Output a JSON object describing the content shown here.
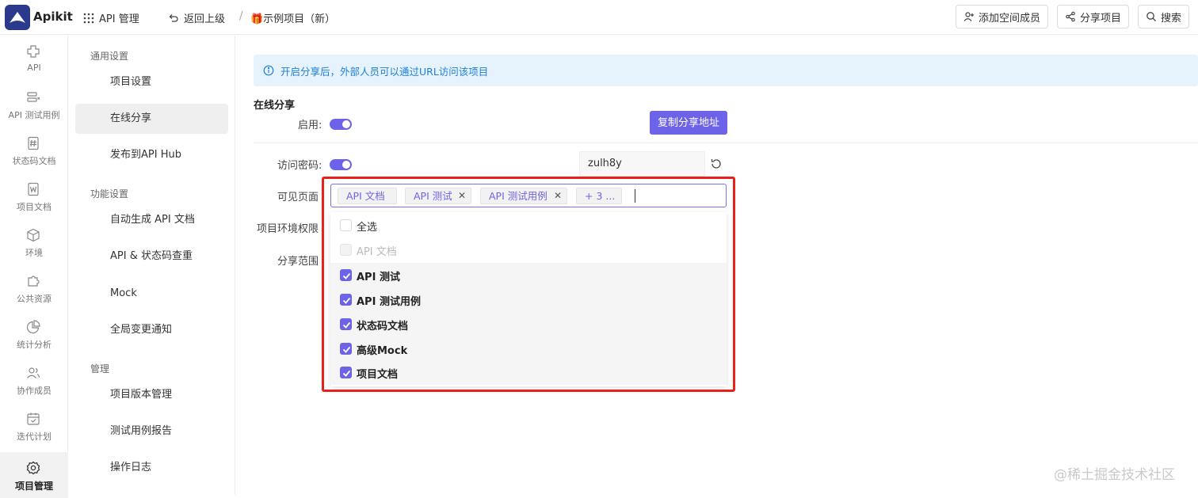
{
  "app": {
    "brand": "Apikit"
  },
  "topbar": {
    "api_manage": "API 管理",
    "back": "返回上级",
    "separator": "/",
    "project": "🎁示例项目（新）",
    "add_member": "添加空间成员",
    "share_project": "分享项目",
    "search": "搜索"
  },
  "rail": {
    "items": [
      {
        "label": "API",
        "icon": "api-icon"
      },
      {
        "label": "API 测试用例",
        "icon": "test-case-icon"
      },
      {
        "label": "状态码文档",
        "icon": "hash-doc-icon"
      },
      {
        "label": "项目文档",
        "icon": "word-doc-icon"
      },
      {
        "label": "环境",
        "icon": "cube-icon"
      },
      {
        "label": "公共资源",
        "icon": "puzzle-icon"
      },
      {
        "label": "统计分析",
        "icon": "pie-chart-icon"
      },
      {
        "label": "协作成员",
        "icon": "users-icon"
      },
      {
        "label": "迭代计划",
        "icon": "calendar-icon"
      },
      {
        "label": "项目管理",
        "icon": "gear-icon"
      }
    ]
  },
  "menu": {
    "group_general": "通用设置",
    "project_settings": "项目设置",
    "online_share": "在线分享",
    "publish_hub": "发布到API Hub",
    "group_features": "功能设置",
    "auto_generate": "自动生成 API 文档",
    "dedupe": "API & 状态码查重",
    "mock": "Mock",
    "global_notice": "全局变更通知",
    "group_manage": "管理",
    "version_manage": "项目版本管理",
    "test_report": "测试用例报告",
    "operation_log": "操作日志"
  },
  "main": {
    "info": "开启分享后，外部人员可以通过URL访问该项目",
    "section_title": "在线分享",
    "enable_label": "启用:",
    "copy_button": "复制分享地址",
    "password_label": "访问密码:",
    "password_value": "zulh8y",
    "visible_label": "可见页面",
    "env_label": "项目环境权限",
    "scope_label": "分享范围"
  },
  "select": {
    "tags": [
      {
        "label": "API 文档",
        "closable": false
      },
      {
        "label": "API 测试",
        "closable": true
      },
      {
        "label": "API 测试用例",
        "closable": true
      },
      {
        "label": "+ 3 ...",
        "closable": false
      }
    ],
    "options": [
      {
        "label": "全选",
        "state": "unchecked"
      },
      {
        "label": "API 文档",
        "state": "disabled"
      },
      {
        "label": "API 测试",
        "state": "checked"
      },
      {
        "label": "API 测试用例",
        "state": "checked"
      },
      {
        "label": "状态码文档",
        "state": "checked"
      },
      {
        "label": "高级Mock",
        "state": "checked"
      },
      {
        "label": "项目文档",
        "state": "checked"
      }
    ]
  },
  "watermark": "@稀土掘金技术社区",
  "colors": {
    "accent": "#6d63e8",
    "highlight": "#e8211b",
    "info_bg": "#e6f3fd",
    "info_text": "#1f7fd6"
  }
}
